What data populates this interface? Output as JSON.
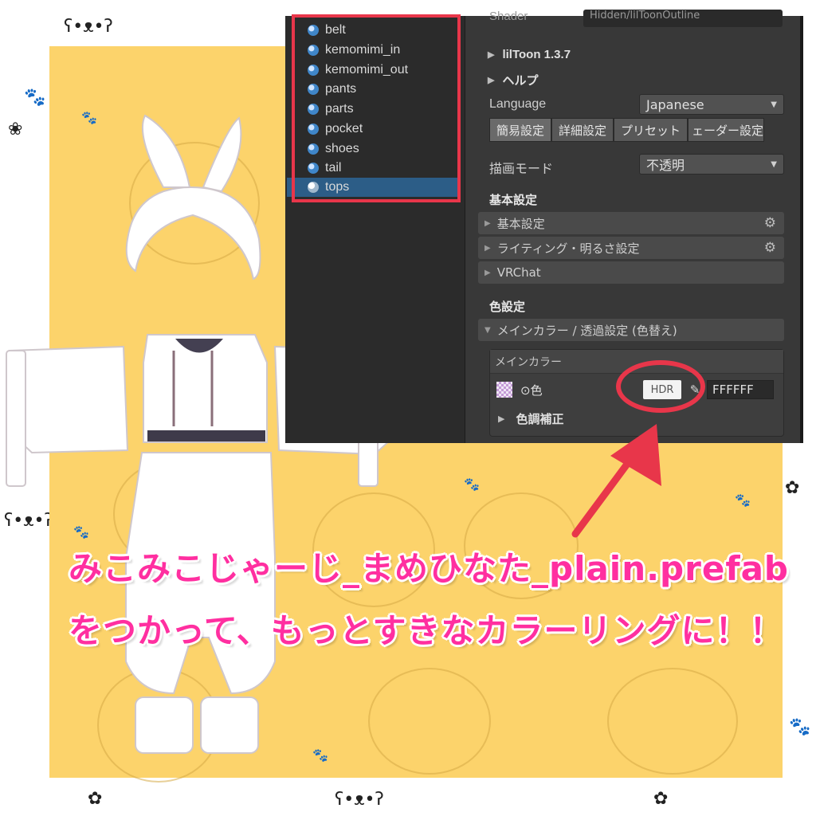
{
  "hierarchy": {
    "items": [
      {
        "label": "belt",
        "selected": false
      },
      {
        "label": "kemomimi_in",
        "selected": false
      },
      {
        "label": "kemomimi_out",
        "selected": false
      },
      {
        "label": "pants",
        "selected": false
      },
      {
        "label": "parts",
        "selected": false
      },
      {
        "label": "pocket",
        "selected": false
      },
      {
        "label": "shoes",
        "selected": false
      },
      {
        "label": "tail",
        "selected": false
      },
      {
        "label": "tops",
        "selected": true
      }
    ]
  },
  "inspector": {
    "shader_label": "Shader",
    "shader_value": "Hidden/lilToonOutline",
    "liltoon_version": "lilToon 1.3.7",
    "help": "ヘルプ",
    "language_label": "Language",
    "language_value": "Japanese",
    "tabs": [
      "簡易設定",
      "詳細設定",
      "プリセット",
      "ェーダー設定"
    ],
    "render_mode_label": "描画モード",
    "render_mode_value": "不透明",
    "basic_section": "基本設定",
    "basic_bars": [
      "基本設定",
      "ライティング・明るさ設定",
      "VRChat"
    ],
    "color_section": "色設定",
    "main_color_bar": "メインカラー / 透過設定 (色替え)",
    "main_color_header": "メインカラー",
    "color_label": "⊙色",
    "hdr_button": "HDR",
    "hex_value": "FFFFFF",
    "tone_correction": "色調補正"
  },
  "caption": {
    "line1": "みこみこじゃーじ_まめひなた_plain.prefab",
    "line2": "をつかって、もっとすきなカラーリングに！！"
  },
  "colors": {
    "accent_red": "#e8364a",
    "caption_pink": "#ff2fa0",
    "panel_yellow": "#fcd36b",
    "selection_blue": "#2c5d87"
  }
}
